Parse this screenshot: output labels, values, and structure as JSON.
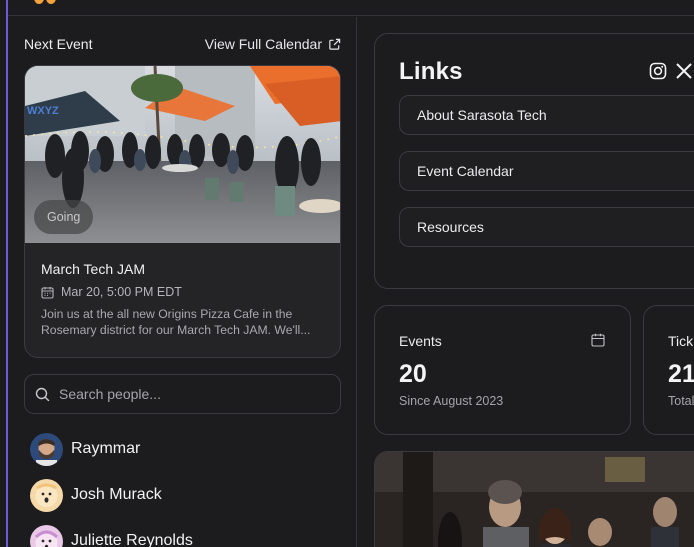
{
  "next_event": {
    "heading": "Next Event",
    "view_calendar_label": "View Full Calendar",
    "badge": "Going",
    "name": "March Tech JAM",
    "date": "Mar 20, 5:00 PM EDT",
    "description_line1": "Join us at the all new Origins Pizza Cafe in the",
    "description_line2": "Rosemary district for our March Tech JAM. We'll..."
  },
  "search": {
    "placeholder": "Search people..."
  },
  "people": [
    {
      "name": "Raymmar",
      "avatar_color": "#2d4a7a"
    },
    {
      "name": "Josh Murack",
      "avatar_color": "#f5d9a8"
    },
    {
      "name": "Juliette Reynolds",
      "avatar_color": "#e9c8e8"
    }
  ],
  "links": {
    "title": "Links",
    "social_icons": [
      "instagram-icon",
      "x-icon"
    ],
    "items": [
      {
        "label": "About Sarasota Tech"
      },
      {
        "label": "Event Calendar"
      },
      {
        "label": "Resources"
      }
    ]
  },
  "stats": [
    {
      "label": "Events",
      "value": "20",
      "sub": "Since August 2023",
      "icon": "calendar-icon"
    },
    {
      "label": "Tick",
      "value": "21",
      "sub": "Total"
    }
  ],
  "colors": {
    "background": "#1c1c1e",
    "border": "#3a3a40",
    "accent_rail": "#6d5ad8",
    "logo": "#f2a33a"
  }
}
